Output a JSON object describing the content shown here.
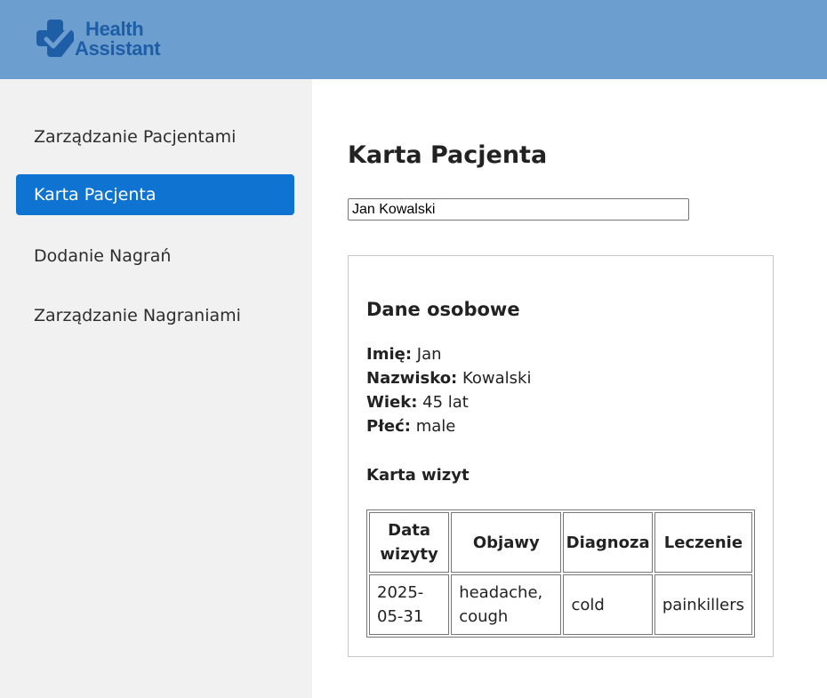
{
  "header": {
    "logo_line1": "Health",
    "logo_line2": "Assistant",
    "brand_color": "#1d5ea6",
    "header_color": "#6c9ecf"
  },
  "sidebar": {
    "items": [
      {
        "label": "Zarządzanie Pacjentami",
        "active": false
      },
      {
        "label": "Karta Pacjenta",
        "active": true
      },
      {
        "label": "Dodanie Nagrań",
        "active": false
      },
      {
        "label": "Zarządzanie Nagraniami",
        "active": false
      }
    ],
    "active_color": "#0f73d1"
  },
  "main": {
    "title": "Karta Pacjenta",
    "search_value": "Jan Kowalski",
    "personal": {
      "section_title": "Dane osobowe",
      "first_name_label": "Imię:",
      "first_name": "Jan",
      "last_name_label": "Nazwisko:",
      "last_name": "Kowalski",
      "age_label": "Wiek:",
      "age": "45 lat",
      "sex_label": "Płeć:",
      "sex": "male"
    },
    "visits": {
      "section_title": "Karta wizyt",
      "headers": [
        "Data wizyty",
        "Objawy",
        "Diagnoza",
        "Leczenie"
      ],
      "rows": [
        [
          "2025-05-31",
          "headache, cough",
          "cold",
          "painkillers"
        ]
      ]
    }
  }
}
